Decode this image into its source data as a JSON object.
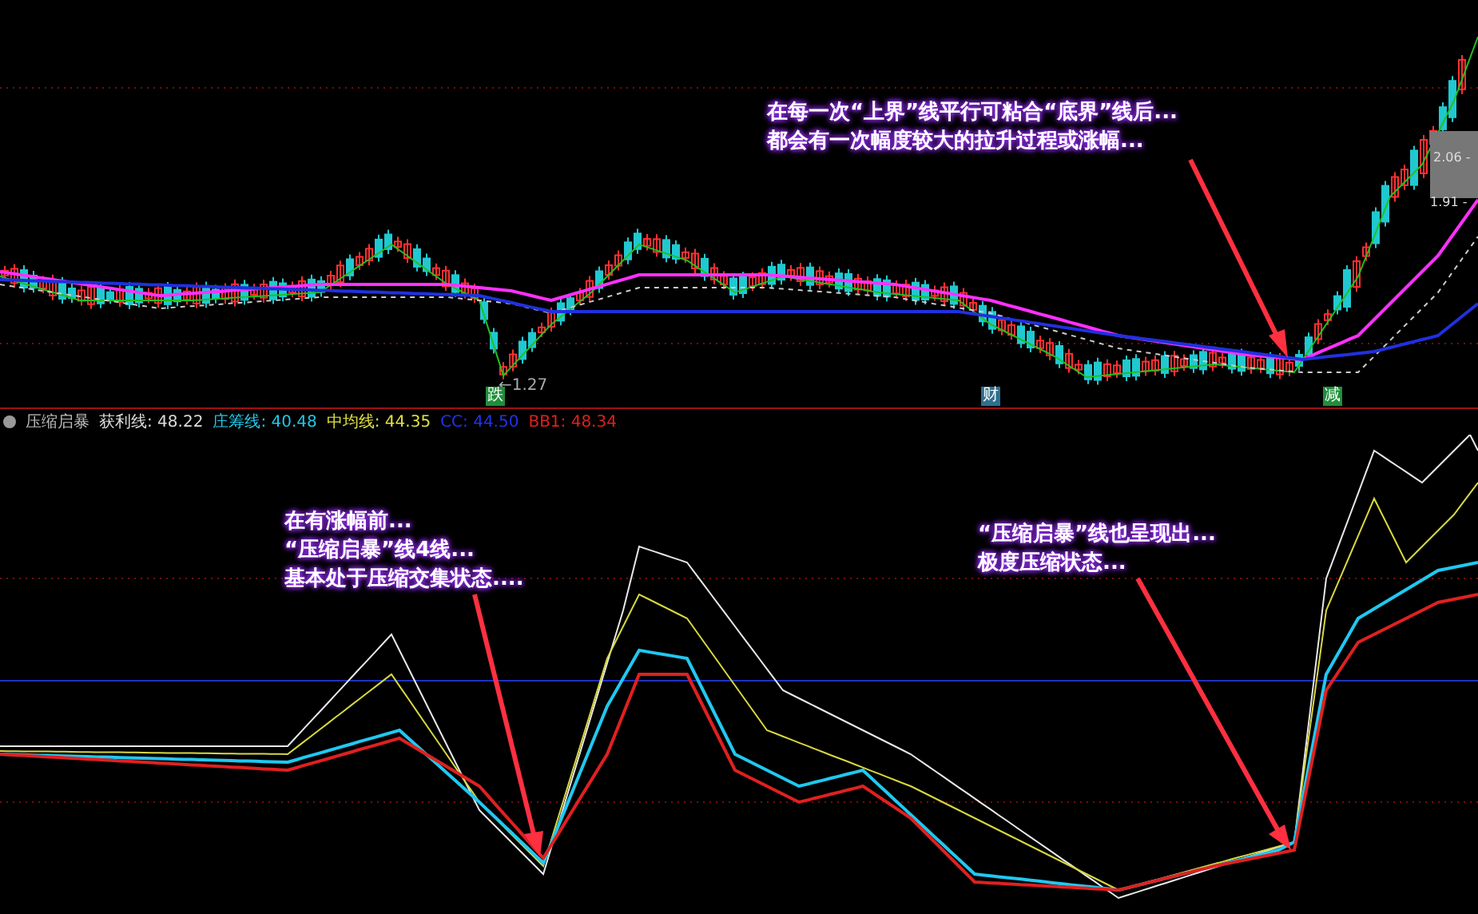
{
  "price_panel": {
    "price_labels": [
      {
        "text": "2.06 -"
      },
      {
        "text": "1.91 -"
      }
    ],
    "low_label": "←1.27",
    "markers": [
      {
        "text": "跌",
        "color": "#1f8f3a"
      },
      {
        "text": "财",
        "color": "#2f6f8f"
      },
      {
        "text": "减",
        "color": "#1f8f3a"
      }
    ],
    "annotation": {
      "lines": [
        "在每一次“上界”线平行可粘合“底界”线后...",
        "都会有一次幅度较大的拉升过程或涨幅..."
      ]
    }
  },
  "indicator_panel": {
    "name": "压缩启暴",
    "values": [
      {
        "label": "获利线:",
        "value": "48.22",
        "color": "#dcdcdc"
      },
      {
        "label": "庄筹线:",
        "value": "40.48",
        "color": "#22c8e8"
      },
      {
        "label": "中均线:",
        "value": "44.35",
        "color": "#e0e040"
      },
      {
        "label": "CC:",
        "value": "44.50",
        "color": "#2233ee"
      },
      {
        "label": "BB1:",
        "value": "48.34",
        "color": "#e02020"
      }
    ],
    "annotations": [
      {
        "lines": [
          "在有涨幅前...",
          "“压缩启暴”线4线...",
          "基本处于压缩交集状态...."
        ]
      },
      {
        "lines": [
          "“压缩启暴”线也呈现出...",
          "极度压缩状态..."
        ]
      }
    ]
  }
}
